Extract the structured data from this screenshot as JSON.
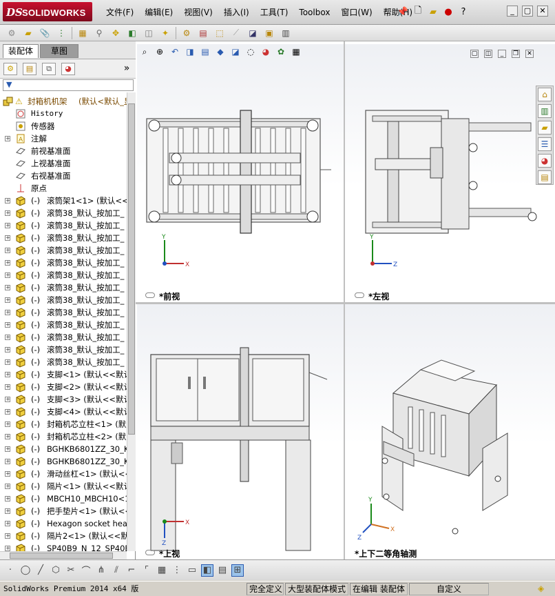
{
  "app": {
    "brand_ds": "DS",
    "brand_name": "SOLIDWORKS"
  },
  "menu": [
    "文件(F)",
    "编辑(E)",
    "视图(V)",
    "插入(I)",
    "工具(T)",
    "Toolbox",
    "窗口(W)",
    "帮助(H)"
  ],
  "panel": {
    "tab_assembly": "装配体",
    "tab_sketch": "草图"
  },
  "tree": {
    "root_name": "封箱机机架",
    "root_config": "(默认<默认_显",
    "items": [
      {
        "label": "History",
        "type": "history",
        "expand": false
      },
      {
        "label": "传感器",
        "type": "sensor",
        "expand": false
      },
      {
        "label": "注解",
        "type": "annot",
        "expand": true
      },
      {
        "label": "前视基准面",
        "type": "plane",
        "expand": false
      },
      {
        "label": "上视基准面",
        "type": "plane",
        "expand": false
      },
      {
        "label": "右视基准面",
        "type": "plane",
        "expand": false
      },
      {
        "label": "原点",
        "type": "origin",
        "expand": false
      },
      {
        "label": "滚筒架1<1> (默认<<默",
        "type": "part",
        "expand": true,
        "state": "(-)"
      },
      {
        "label": "滚筒38_默认_按加工_",
        "type": "part",
        "expand": true,
        "state": "(-)"
      },
      {
        "label": "滚筒38_默认_按加工_",
        "type": "part",
        "expand": true,
        "state": "(-)"
      },
      {
        "label": "滚筒38_默认_按加工_",
        "type": "part",
        "expand": true,
        "state": "(-)"
      },
      {
        "label": "滚筒38_默认_按加工_",
        "type": "part",
        "expand": true,
        "state": "(-)"
      },
      {
        "label": "滚筒38_默认_按加工_",
        "type": "part",
        "expand": true,
        "state": "(-)"
      },
      {
        "label": "滚筒38_默认_按加工_",
        "type": "part",
        "expand": true,
        "state": "(-)"
      },
      {
        "label": "滚筒38_默认_按加工_",
        "type": "part",
        "expand": true,
        "state": "(-)"
      },
      {
        "label": "滚筒38_默认_按加工_",
        "type": "part",
        "expand": true,
        "state": "(-)"
      },
      {
        "label": "滚筒38_默认_按加工_",
        "type": "part",
        "expand": true,
        "state": "(-)"
      },
      {
        "label": "滚筒38_默认_按加工_",
        "type": "part",
        "expand": true,
        "state": "(-)"
      },
      {
        "label": "滚筒38_默认_按加工_",
        "type": "part",
        "expand": true,
        "state": "(-)"
      },
      {
        "label": "滚筒38_默认_按加工_",
        "type": "part",
        "expand": true,
        "state": "(-)"
      },
      {
        "label": "滚筒38_默认_按加工_",
        "type": "part",
        "expand": true,
        "state": "(-)"
      },
      {
        "label": "支脚<1> (默认<<默认",
        "type": "part",
        "expand": true,
        "state": "(-)"
      },
      {
        "label": "支脚<2> (默认<<默认",
        "type": "part",
        "expand": true,
        "state": "(-)"
      },
      {
        "label": "支脚<3> (默认<<默认",
        "type": "part",
        "expand": true,
        "state": "(-)"
      },
      {
        "label": "支脚<4> (默认<<默认",
        "type": "part",
        "expand": true,
        "state": "(-)"
      },
      {
        "label": "封箱机芯立柱<1> (默",
        "type": "part",
        "expand": true,
        "state": "(-)"
      },
      {
        "label": "封箱机芯立柱<2> (默",
        "type": "part",
        "expand": true,
        "state": "(-)"
      },
      {
        "label": "BGHKB6801ZZ_30_KCC_",
        "type": "part",
        "expand": true,
        "state": "(-)"
      },
      {
        "label": "BGHKB6801ZZ_30_KCC_",
        "type": "part",
        "expand": true,
        "state": "(-)"
      },
      {
        "label": "滑动丝杠<1> (默认<<",
        "type": "part",
        "expand": true,
        "state": "(-)"
      },
      {
        "label": "隔片<1> (默认<<默认",
        "type": "part",
        "expand": true,
        "state": "(-)"
      },
      {
        "label": "MBCH10_MBCH10<1> (默",
        "type": "part",
        "expand": true,
        "state": "(-)"
      },
      {
        "label": "把手垫片<1> (默认<<",
        "type": "part",
        "expand": true,
        "state": "(-)"
      },
      {
        "label": "Hexagon socket head",
        "type": "part",
        "expand": true,
        "state": "(-)"
      },
      {
        "label": "隔片2<1> (默认<<默认",
        "type": "part",
        "expand": true,
        "state": "(-)"
      },
      {
        "label": "SP40B9_N_12_SP40B9-",
        "type": "part",
        "expand": true,
        "state": "(-)"
      }
    ]
  },
  "views": {
    "front": "*前视",
    "left": "*左视",
    "top": "*上视",
    "iso": "*上下二等角轴测"
  },
  "axes": {
    "x": "X",
    "y": "Y",
    "z": "Z"
  },
  "status": {
    "version": "SolidWorks Premium 2014 x64 版",
    "defined": "完全定义",
    "mode": "大型装配体模式",
    "editing": "在编辑 装配体",
    "custom": "自定义"
  }
}
